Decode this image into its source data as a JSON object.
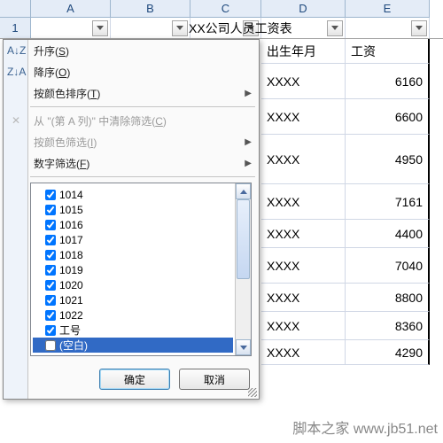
{
  "columns": [
    "A",
    "B",
    "C",
    "D",
    "E"
  ],
  "row1_number": "1",
  "title_cell": "XX公司人员工资表",
  "header_row": {
    "d": "出生年月",
    "e": "工资"
  },
  "data_rows": [
    {
      "d": "XXXX",
      "e": "6160"
    },
    {
      "d": "XXXX",
      "e": "6600"
    },
    {
      "d": "XXXX",
      "e": "4950"
    },
    {
      "d": "XXXX",
      "e": "7161"
    },
    {
      "d": "XXXX",
      "e": "4400"
    },
    {
      "d": "XXXX",
      "e": "7040"
    },
    {
      "d": "XXXX",
      "e": "8800"
    },
    {
      "d": "XXXX",
      "e": "8360"
    },
    {
      "d": "XXXX",
      "e": "4290"
    }
  ],
  "menu": {
    "sort_asc": "升序(",
    "sort_asc_u": "S",
    "sort_asc_end": ")",
    "sort_desc": "降序(",
    "sort_desc_u": "O",
    "sort_desc_end": ")",
    "sort_color": "按颜色排序(",
    "sort_color_u": "T",
    "sort_color_end": ")",
    "clear_filter": "从 \"(第 A 列)\" 中清除筛选(",
    "clear_filter_u": "C",
    "clear_filter_end": ")",
    "filter_color": "按颜色筛选(",
    "filter_color_u": "I",
    "filter_color_end": ")",
    "number_filter": "数字筛选(",
    "number_filter_u": "F",
    "number_filter_end": ")"
  },
  "sort_icon_az": "A↓Z",
  "sort_icon_za": "Z↓A",
  "clear_icon": "✕",
  "filter_items": [
    {
      "label": "1014",
      "checked": true
    },
    {
      "label": "1015",
      "checked": true
    },
    {
      "label": "1016",
      "checked": true
    },
    {
      "label": "1017",
      "checked": true
    },
    {
      "label": "1018",
      "checked": true
    },
    {
      "label": "1019",
      "checked": true
    },
    {
      "label": "1020",
      "checked": true
    },
    {
      "label": "1021",
      "checked": true
    },
    {
      "label": "1022",
      "checked": true
    },
    {
      "label": "工号",
      "checked": true
    },
    {
      "label": "(空白)",
      "checked": false,
      "selected": true
    }
  ],
  "buttons": {
    "ok": "确定",
    "cancel": "取消"
  },
  "watermark": "脚本之家 www.jb51.net"
}
